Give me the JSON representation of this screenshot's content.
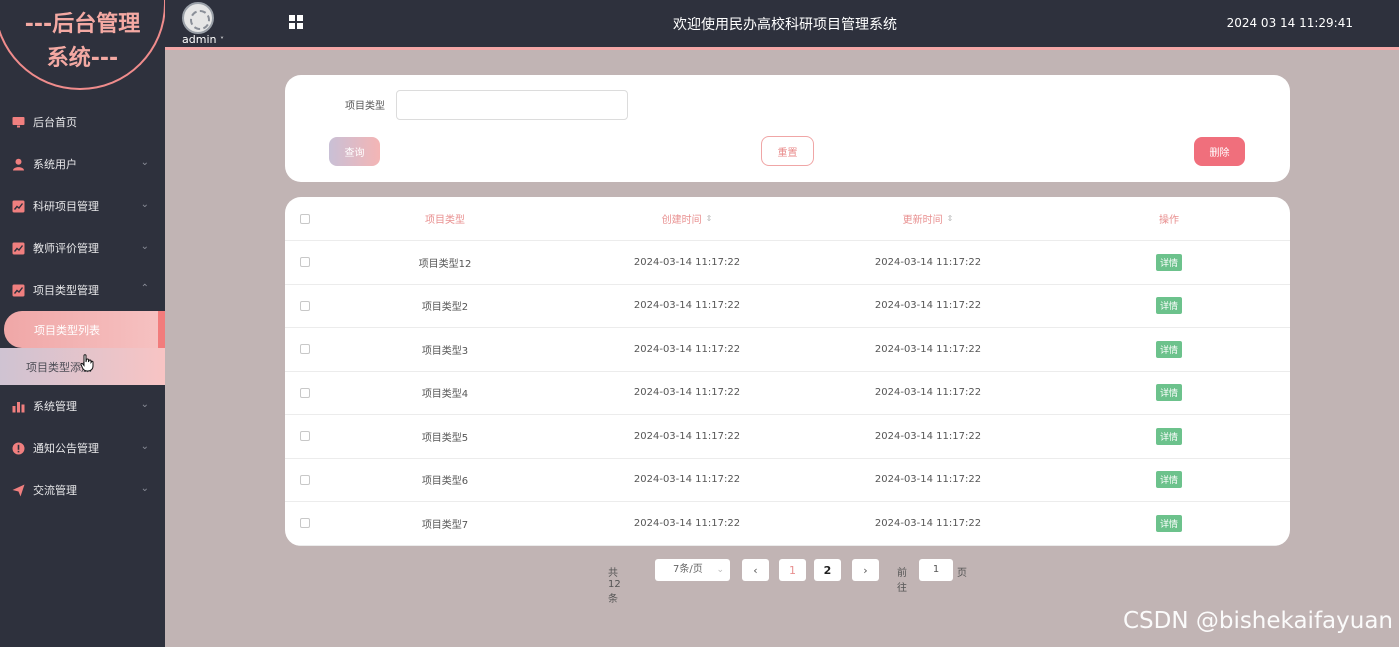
{
  "logo": {
    "line1": "---后台管理",
    "line2": "系统---"
  },
  "header": {
    "username": "admin",
    "user_caret": "˅",
    "title": "欢迎使用民办高校科研项目管理系统",
    "datetime": "2024 03 14 11:29:41"
  },
  "sidebar": {
    "items": [
      {
        "label": "后台首页",
        "icon": "monitor-icon",
        "chevron": ""
      },
      {
        "label": "系统用户",
        "icon": "user-icon",
        "chevron": "⌄"
      },
      {
        "label": "科研项目管理",
        "icon": "chart-icon",
        "chevron": "⌄"
      },
      {
        "label": "教师评价管理",
        "icon": "chart-icon",
        "chevron": "⌄"
      },
      {
        "label": "项目类型管理",
        "icon": "chart-icon",
        "chevron": "⌃"
      }
    ],
    "subitems": [
      {
        "label": "项目类型列表"
      },
      {
        "label": "项目类型添加"
      }
    ],
    "items_after": [
      {
        "label": "系统管理",
        "icon": "bar-chart-icon",
        "chevron": "⌄"
      },
      {
        "label": "通知公告管理",
        "icon": "info-icon",
        "chevron": "⌄"
      },
      {
        "label": "交流管理",
        "icon": "send-icon",
        "chevron": "⌄"
      }
    ]
  },
  "search": {
    "label": "项目类型",
    "value": "",
    "placeholder": "",
    "query_label": "查询",
    "reset_label": "重置",
    "delete_label": "删除"
  },
  "table": {
    "headers": {
      "type": "项目类型",
      "created": "创建时间",
      "updated": "更新时间",
      "action": "操作"
    },
    "sort_glyph": "⇕",
    "rows": [
      {
        "type": "项目类型12",
        "created": "2024-03-14 11:17:22",
        "updated": "2024-03-14 11:17:22",
        "action": "详情"
      },
      {
        "type": "项目类型2",
        "created": "2024-03-14 11:17:22",
        "updated": "2024-03-14 11:17:22",
        "action": "详情"
      },
      {
        "type": "项目类型3",
        "created": "2024-03-14 11:17:22",
        "updated": "2024-03-14 11:17:22",
        "action": "详情"
      },
      {
        "type": "项目类型4",
        "created": "2024-03-14 11:17:22",
        "updated": "2024-03-14 11:17:22",
        "action": "详情"
      },
      {
        "type": "项目类型5",
        "created": "2024-03-14 11:17:22",
        "updated": "2024-03-14 11:17:22",
        "action": "详情"
      },
      {
        "type": "项目类型6",
        "created": "2024-03-14 11:17:22",
        "updated": "2024-03-14 11:17:22",
        "action": "详情"
      },
      {
        "type": "项目类型7",
        "created": "2024-03-14 11:17:22",
        "updated": "2024-03-14 11:17:22",
        "action": "详情"
      }
    ]
  },
  "pagination": {
    "total": "共 12 条",
    "page_size": "7条/页",
    "prev": "‹",
    "next": "›",
    "pages": [
      "1",
      "2"
    ],
    "current_page": "2",
    "goto_label": "前往",
    "goto_value": "1",
    "page_unit": "页"
  },
  "watermark": "CSDN @bishekaifayuan",
  "colors": {
    "accent": "#f3a7a7",
    "sidebar_bg": "#2e313d",
    "content_bg": "#c1b4b4",
    "detail_green": "#6cc28c",
    "delete_red": "#f06f7c"
  }
}
